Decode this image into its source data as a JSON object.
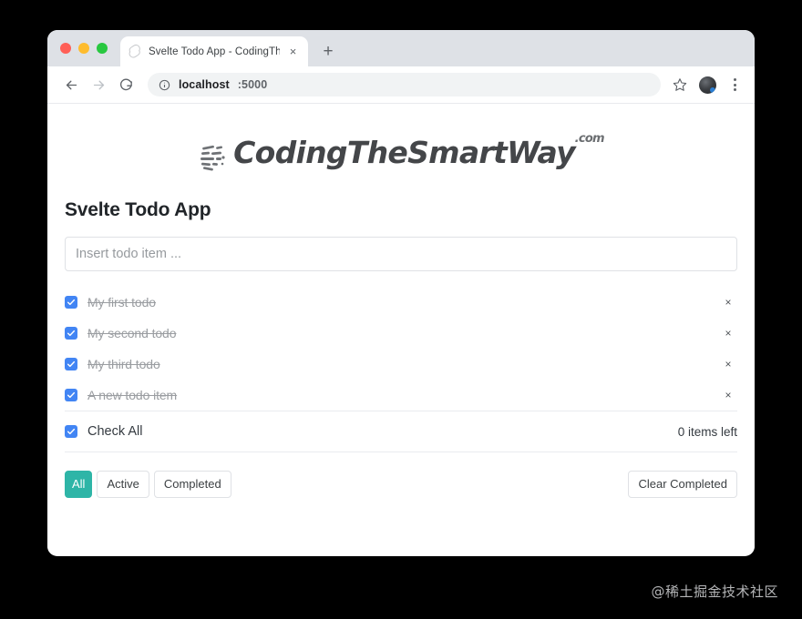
{
  "browser": {
    "traffic_lights": [
      "close",
      "minimize",
      "zoom"
    ],
    "tab": {
      "favicon": "svelte-icon",
      "title": "Svelte Todo App - CodingTheS",
      "close_label": "×"
    },
    "new_tab_label": "+",
    "toolbar": {
      "back_label": "←",
      "forward_label": "→",
      "reload_label": "⟳",
      "info_icon": "info-icon",
      "url_host": "localhost",
      "url_port": ":5000",
      "star_label": "☆",
      "avatar": "user-avatar",
      "menu_label": "⋮"
    }
  },
  "site": {
    "logo": {
      "mark": "speedlines-icon",
      "text": "CodingTheSmartWay",
      "tld": ".com"
    }
  },
  "app": {
    "title": "Svelte Todo App",
    "input": {
      "placeholder": "Insert todo item ...",
      "value": ""
    },
    "todos": [
      {
        "label": "My first todo",
        "completed": true,
        "delete_label": "×"
      },
      {
        "label": "My second todo",
        "completed": true,
        "delete_label": "×"
      },
      {
        "label": "My third todo",
        "completed": true,
        "delete_label": "×"
      },
      {
        "label": "A new todo item",
        "completed": true,
        "delete_label": "×"
      }
    ],
    "check_all": {
      "label": "Check All",
      "checked": true
    },
    "items_left": "0 items left",
    "filters": [
      {
        "label": "All",
        "active": true
      },
      {
        "label": "Active",
        "active": false
      },
      {
        "label": "Completed",
        "active": false
      }
    ],
    "clear_completed_label": "Clear Completed"
  },
  "watermark": "@稀土掘金技术社区",
  "colors": {
    "accent_teal": "#2eb5a7",
    "checkbox_blue": "#4285f4",
    "tabstrip_grey": "#dee1e6",
    "muted_text": "#9a9da1"
  }
}
